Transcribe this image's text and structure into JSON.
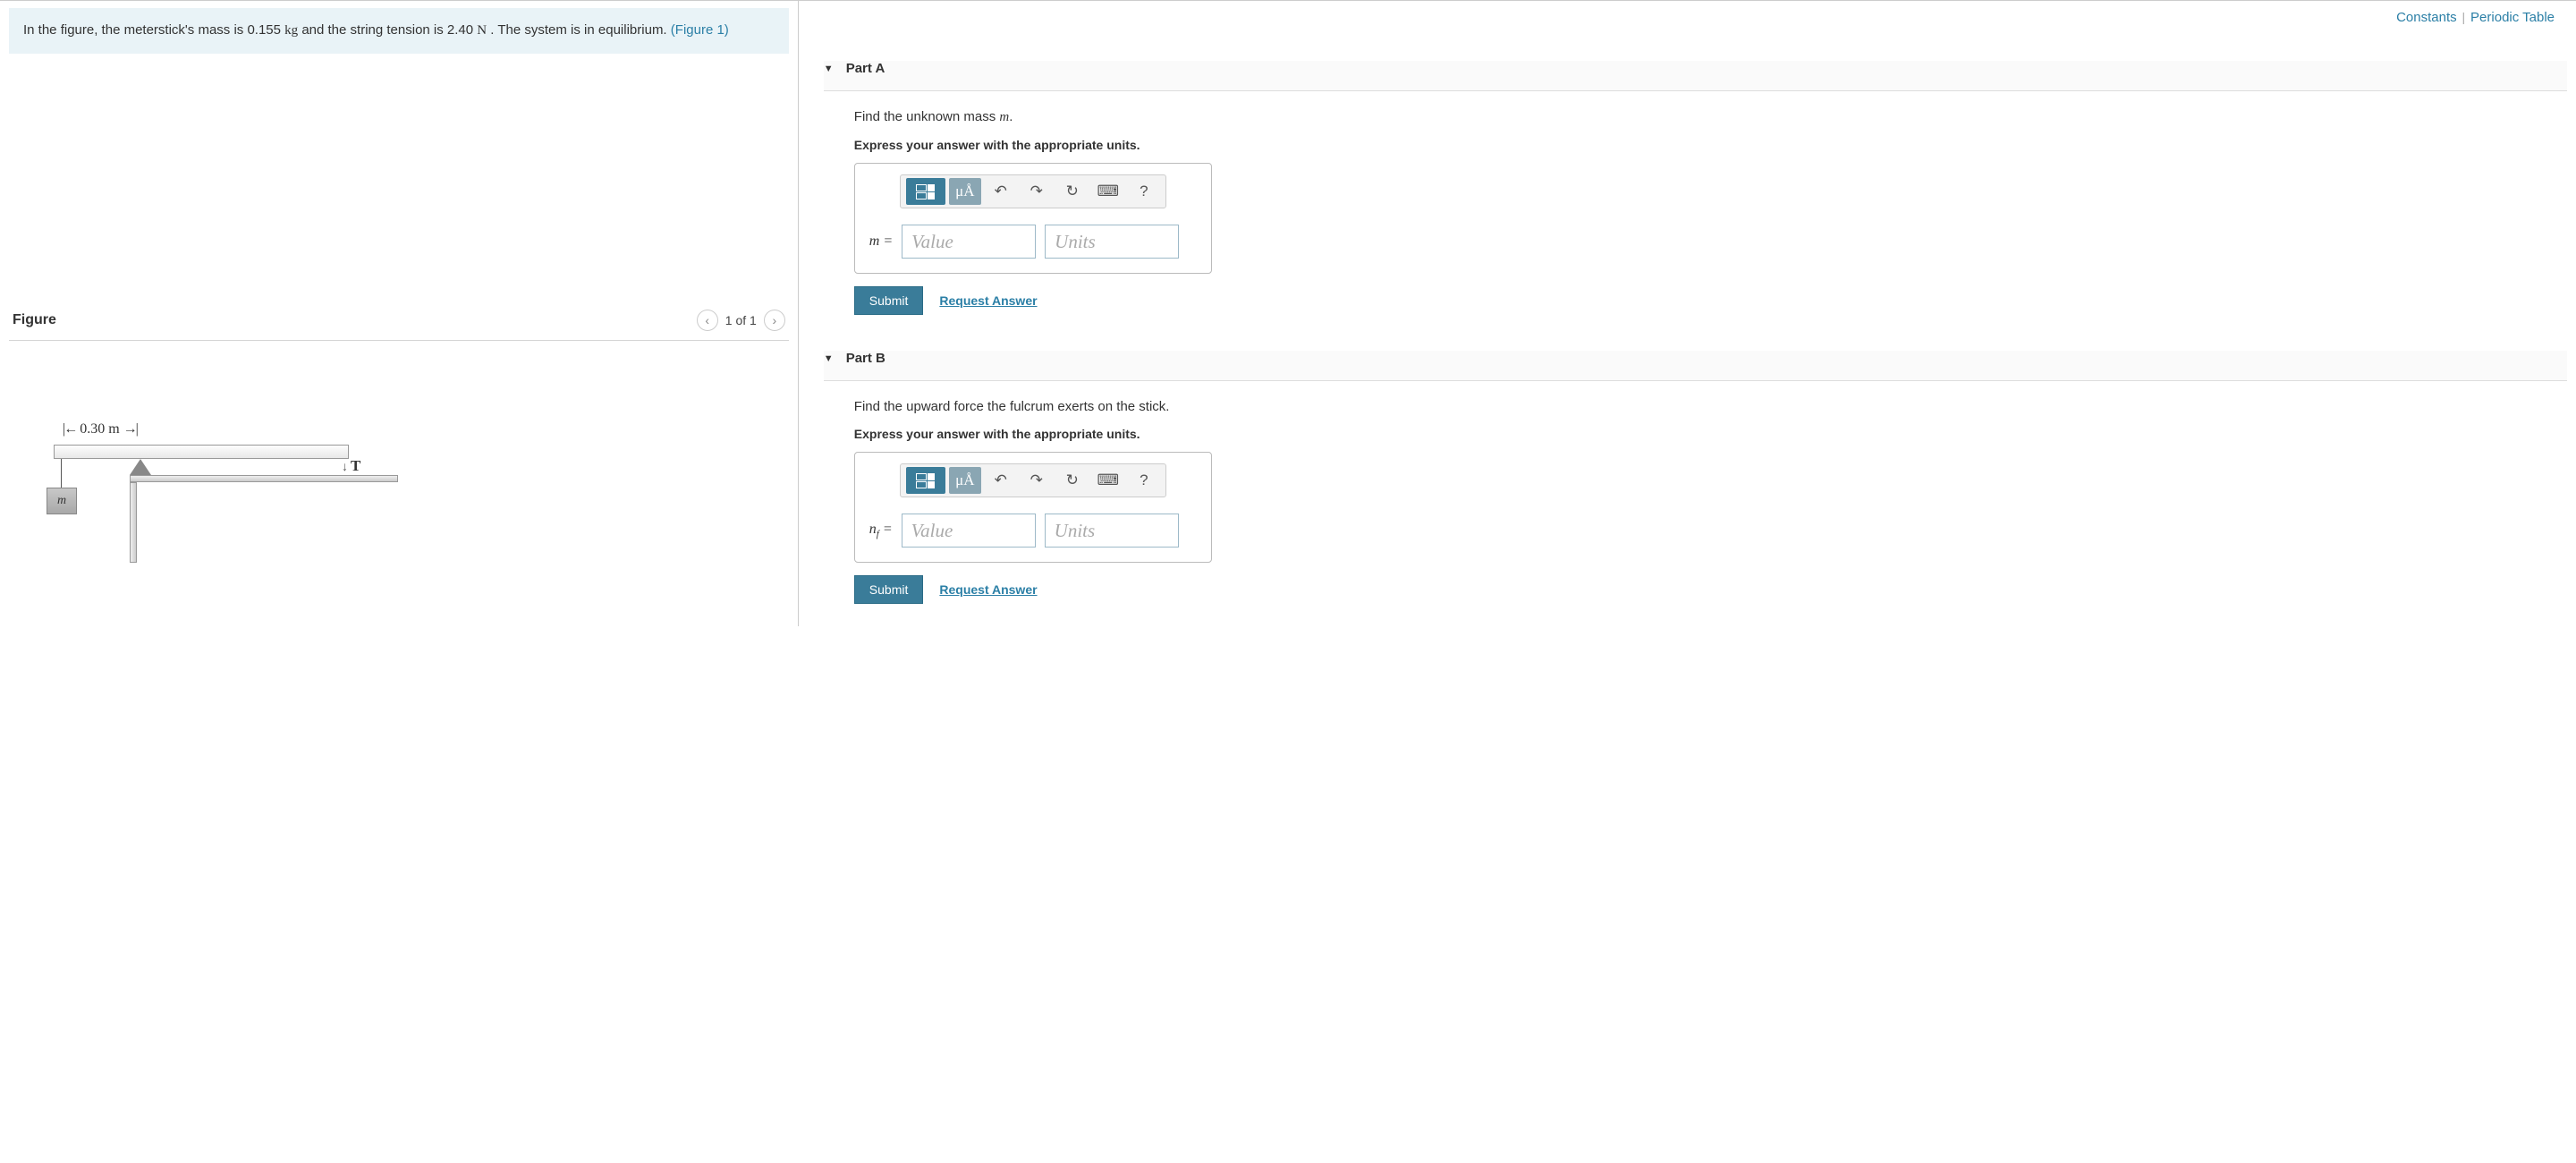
{
  "top_links": {
    "constants": "Constants",
    "periodic": "Periodic Table"
  },
  "problem": {
    "text_a": "In the figure, the meterstick's mass is 0.155 ",
    "unit_kg": "kg",
    "text_b": " and the string tension is 2.40 ",
    "unit_n": "N",
    "text_c": " . The system is in equilibrium. ",
    "fig_link": "(Figure 1)"
  },
  "figure": {
    "title": "Figure",
    "pager": "1 of 1",
    "dim_left": "0.30 m",
    "mass_label": "m",
    "tension_label": "T"
  },
  "parts": [
    {
      "title": "Part A",
      "instruction_a": "Find the unknown mass ",
      "instruction_var": "m",
      "instruction_b": ".",
      "bold": "Express your answer with the appropriate units.",
      "eq_label": "m",
      "eq_sub": "",
      "equals": " = ",
      "value_placeholder": "Value",
      "units_placeholder": "Units",
      "submit": "Submit",
      "request": "Request Answer"
    },
    {
      "title": "Part B",
      "instruction_a": "Find the upward force the fulcrum exerts on the stick.",
      "instruction_var": "",
      "instruction_b": "",
      "bold": "Express your answer with the appropriate units.",
      "eq_label": "n",
      "eq_sub": "f",
      "equals": " = ",
      "value_placeholder": "Value",
      "units_placeholder": "Units",
      "submit": "Submit",
      "request": "Request Answer"
    }
  ],
  "toolbar": {
    "ua": "μÅ",
    "help": "?"
  }
}
